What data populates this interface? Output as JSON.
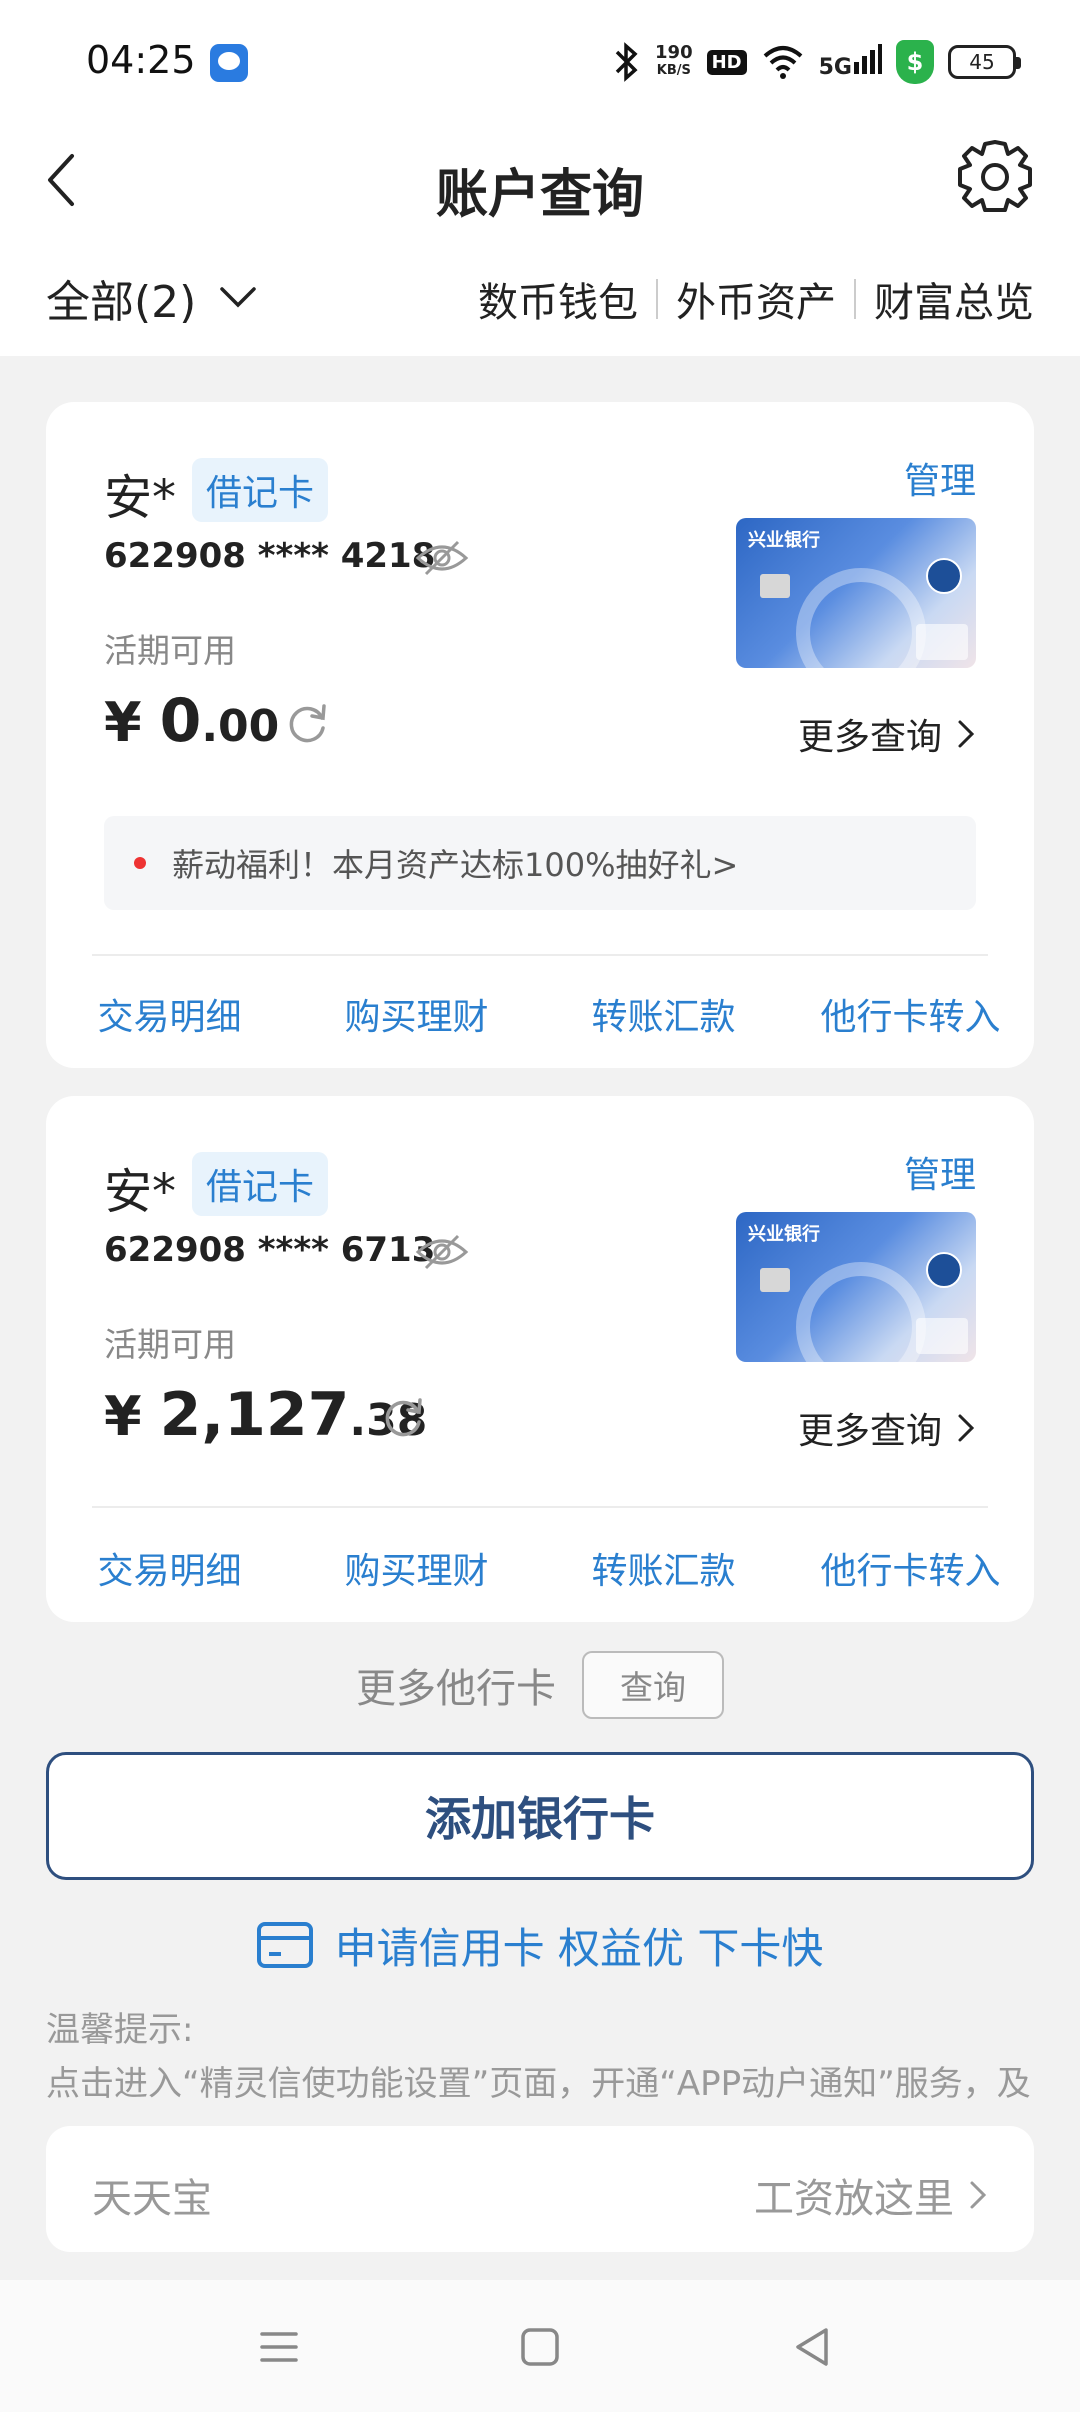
{
  "status_bar": {
    "time": "04:25",
    "speed_value": "190",
    "speed_unit": "KB/S",
    "hd": "HD",
    "network": "5G",
    "battery": "45"
  },
  "header": {
    "title": "账户查询"
  },
  "filter": {
    "all_label": "全部(2)",
    "links": [
      "数币钱包",
      "外币资产",
      "财富总览"
    ]
  },
  "cards": [
    {
      "owner": "安*",
      "type": "借记卡",
      "manage": "管理",
      "account": "622908 **** 4218",
      "balance_label": "活期可用",
      "currency": "¥",
      "balance_int": "0",
      "balance_dec": ".00",
      "bank_name": "兴业银行",
      "more_query": "更多查询",
      "promo": "薪动福利！本月资产达标100%抽好礼>",
      "actions": [
        "交易明细",
        "购买理财",
        "转账汇款",
        "他行卡转入"
      ]
    },
    {
      "owner": "安*",
      "type": "借记卡",
      "manage": "管理",
      "account": "622908 **** 6713",
      "balance_label": "活期可用",
      "currency": "¥",
      "balance_int": "2,127",
      "balance_dec": ".38",
      "bank_name": "兴业银行",
      "more_query": "更多查询",
      "actions": [
        "交易明细",
        "购买理财",
        "转账汇款",
        "他行卡转入"
      ]
    }
  ],
  "more_cards": {
    "label": "更多他行卡",
    "button": "查询"
  },
  "add_card": "添加银行卡",
  "credit_card": "申请信用卡 权益优 下卡快",
  "tips": {
    "title": "温馨提示:",
    "text": "点击进入“精灵信使功能设置”页面，开通“APP动户通知”服务，及"
  },
  "tiantianbao": {
    "label": "天天宝",
    "right": "工资放这里"
  },
  "colors": {
    "accent": "#2a7fcf",
    "primary_dark": "#2e4f7f",
    "background": "#f2f2f2"
  }
}
